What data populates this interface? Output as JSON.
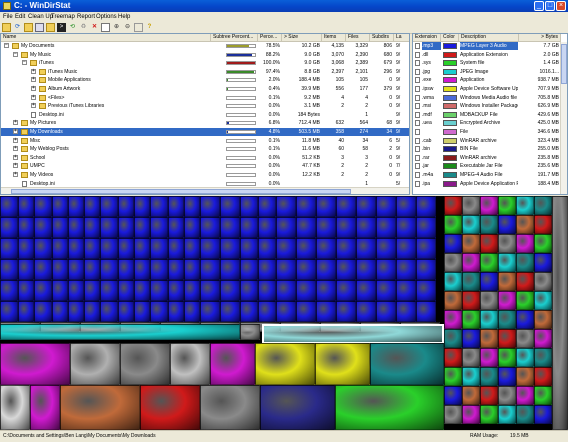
{
  "window": {
    "title": "C: - WinDirStat"
  },
  "menu": [
    "File",
    "Edit",
    "Clean Up",
    "Treemap",
    "Report",
    "Options",
    "Help"
  ],
  "tree_columns": [
    "Name",
    "Subtree Percent...",
    "Perce...",
    "> Size",
    "Items",
    "Files",
    "Subdirs",
    "La"
  ],
  "tree_rows": [
    {
      "name": "My Documents",
      "depth": 1,
      "toggle": "-",
      "icon": "folder",
      "bar": 0.785,
      "bar_color": "#9c9c2a",
      "percent": "78.5%",
      "size": "10.2 GB",
      "items": "4,135",
      "files": "3,329",
      "subdirs": "806",
      "last": "9/"
    },
    {
      "name": "My Music",
      "depth": 2,
      "toggle": "-",
      "icon": "folder",
      "bar": 0.882,
      "bar_color": "#1a2f9a",
      "percent": "88.2%",
      "size": "9.0 GB",
      "items": "3,070",
      "files": "2,390",
      "subdirs": "680",
      "last": "9/"
    },
    {
      "name": "iTunes",
      "depth": 3,
      "toggle": "-",
      "icon": "folder",
      "bar": 1.0,
      "bar_color": "#a01a1a",
      "percent": "100.0%",
      "size": "9.0 GB",
      "items": "3,068",
      "files": "2,389",
      "subdirs": "679",
      "last": "9/"
    },
    {
      "name": "iTunes Music",
      "depth": 4,
      "toggle": "+",
      "icon": "folder",
      "bar": 0.974,
      "bar_color": "#3a8a2a",
      "percent": "97.4%",
      "size": "8.8 GB",
      "items": "2,397",
      "files": "2,101",
      "subdirs": "296",
      "last": "9/"
    },
    {
      "name": "Mobile Applications",
      "depth": 4,
      "toggle": "+",
      "icon": "folder",
      "bar": 0.02,
      "bar_color": "#3a8a2a",
      "percent": "2.0%",
      "size": "188.4 MB",
      "items": "105",
      "files": "105",
      "subdirs": "0",
      "last": "9/"
    },
    {
      "name": "Album Artwork",
      "depth": 4,
      "toggle": "+",
      "icon": "folder",
      "bar": 0.004,
      "bar_color": "#3a8a2a",
      "percent": "0.4%",
      "size": "39.9 MB",
      "items": "556",
      "files": "177",
      "subdirs": "379",
      "last": "9/"
    },
    {
      "name": "<Files>",
      "depth": 4,
      "toggle": "+",
      "icon": "folder",
      "bar": 0.001,
      "bar_color": "#3a8a2a",
      "percent": "0.1%",
      "size": "9.2 MB",
      "items": "4",
      "files": "4",
      "subdirs": "0",
      "last": "9/"
    },
    {
      "name": "Previous iTunes Libraries",
      "depth": 4,
      "toggle": "+",
      "icon": "folder",
      "bar": 0.0,
      "bar_color": "#3a8a2a",
      "percent": "0.0%",
      "size": "3.1 MB",
      "items": "2",
      "files": "2",
      "subdirs": "0",
      "last": "9/"
    },
    {
      "name": "Desktop.ini",
      "depth": 3,
      "toggle": "",
      "icon": "file",
      "bar": 0.0,
      "bar_color": "#3a8a2a",
      "percent": "0.0%",
      "size": "184 Bytes",
      "items": "",
      "files": "1",
      "subdirs": "",
      "last": "9/"
    },
    {
      "name": "My Pictures",
      "depth": 2,
      "toggle": "+",
      "icon": "folder",
      "bar": 0.068,
      "bar_color": "#1a2f9a",
      "percent": "6.8%",
      "size": "712.4 MB",
      "items": "632",
      "files": "564",
      "subdirs": "68",
      "last": "9/"
    },
    {
      "name": "My Downloads",
      "depth": 2,
      "toggle": "+",
      "icon": "folder",
      "bar": 0.048,
      "bar_color": "#1a2f9a",
      "percent": "4.8%",
      "size": "503.5 MB",
      "items": "358",
      "files": "274",
      "subdirs": "34",
      "last": "9/",
      "selected": true
    },
    {
      "name": "Misc",
      "depth": 2,
      "toggle": "+",
      "icon": "folder",
      "bar": 0.001,
      "bar_color": "#1a2f9a",
      "percent": "0.1%",
      "size": "11.8 MB",
      "items": "40",
      "files": "34",
      "subdirs": "6",
      "last": "5/"
    },
    {
      "name": "My Weblog Posts",
      "depth": 2,
      "toggle": "+",
      "icon": "folder",
      "bar": 0.001,
      "bar_color": "#1a2f9a",
      "percent": "0.1%",
      "size": "11.6 MB",
      "items": "60",
      "files": "58",
      "subdirs": "2",
      "last": "9/"
    },
    {
      "name": "School",
      "depth": 2,
      "toggle": "+",
      "icon": "folder",
      "bar": 0.0,
      "bar_color": "#1a2f9a",
      "percent": "0.0%",
      "size": "51.2 KB",
      "items": "3",
      "files": "3",
      "subdirs": "0",
      "last": "9/"
    },
    {
      "name": "UMPC",
      "depth": 2,
      "toggle": "+",
      "icon": "folder",
      "bar": 0.0,
      "bar_color": "#1a2f9a",
      "percent": "0.0%",
      "size": "47.7 KB",
      "items": "2",
      "files": "2",
      "subdirs": "0",
      "last": "7/"
    },
    {
      "name": "My Videos",
      "depth": 2,
      "toggle": "+",
      "icon": "folder",
      "bar": 0.0,
      "bar_color": "#1a2f9a",
      "percent": "0.0%",
      "size": "12.2 KB",
      "items": "2",
      "files": "2",
      "subdirs": "0",
      "last": "9/"
    },
    {
      "name": "Desktop.ini",
      "depth": 2,
      "toggle": "",
      "icon": "file",
      "bar": 0.0,
      "bar_color": "#1a2f9a",
      "percent": "0.0%",
      "size": "",
      "items": "",
      "files": "1",
      "subdirs": "",
      "last": "5/"
    }
  ],
  "ext_columns": [
    "Extension",
    "Color",
    "Description",
    "> Bytes"
  ],
  "ext_rows": [
    {
      "ext": ".mp3",
      "color": "#1a1add",
      "desc": "MPEG Layer 3 Audio",
      "bytes": "7.7 GB",
      "selected": true
    },
    {
      "ext": ".dll",
      "color": "#d01a1a",
      "desc": "Application Extension",
      "bytes": "2.0 GB"
    },
    {
      "ext": ".sys",
      "color": "#2ad02a",
      "desc": "System file",
      "bytes": "1.4 GB"
    },
    {
      "ext": ".jpg",
      "color": "#1acfcf",
      "desc": "JPEG Image",
      "bytes": "1016.1..."
    },
    {
      "ext": ".exe",
      "color": "#d01ad0",
      "desc": "Application",
      "bytes": "938.7 MB"
    },
    {
      "ext": ".ipsw",
      "color": "#e0e01a",
      "desc": "Apple Device Software Updat...",
      "bytes": "707.9 MB"
    },
    {
      "ext": ".wma",
      "color": "#4a6ad8",
      "desc": "Windows Media Audio file",
      "bytes": "705.8 MB"
    },
    {
      "ext": ".msi",
      "color": "#d06a6a",
      "desc": "Windows Installer Package",
      "bytes": "626.9 MB"
    },
    {
      "ext": ".mdf",
      "color": "#6ad06a",
      "desc": "MDBACKUP File",
      "bytes": "429.6 MB"
    },
    {
      "ext": ".uea",
      "color": "#6acfcf",
      "desc": "Encrypted Archive",
      "bytes": "425.0 MB"
    },
    {
      "ext": "",
      "color": "#cf6acf",
      "desc": "File",
      "bytes": "346.6 MB"
    },
    {
      "ext": ".cab",
      "color": "#cfcf6a",
      "desc": "WinRAR archive",
      "bytes": "323.4 MB"
    },
    {
      "ext": ".bin",
      "color": "#1a1a8a",
      "desc": "BIN File",
      "bytes": "255.0 MB"
    },
    {
      "ext": ".rar",
      "color": "#8a1a1a",
      "desc": "WinRAR archive",
      "bytes": "235.8 MB"
    },
    {
      "ext": ".jar",
      "color": "#1a8a1a",
      "desc": "Executable Jar File",
      "bytes": "235.6 MB"
    },
    {
      "ext": ".m4a",
      "color": "#1a8a8a",
      "desc": "MPEG-4 Audio File",
      "bytes": "191.7 MB"
    },
    {
      "ext": ".ipa",
      "color": "#8a1a8a",
      "desc": "Apple Device Application File",
      "bytes": "188.4 MB"
    }
  ],
  "treemap": {
    "accent_colors": {
      "mp3": "#1a1add",
      "jpg": "#1acfcf",
      "exe": "#d01ad0",
      "ipsw": "#e0e01a",
      "sys": "#2ad02a",
      "dll": "#d01a1a",
      "other": "#8a8a8a"
    }
  },
  "statusbar": {
    "path": "C:\\Documents and Settings\\Ben Lang\\My Documents\\My Downloads",
    "ram_label": "RAM Usage:",
    "ram_value": "19.5 MB"
  }
}
